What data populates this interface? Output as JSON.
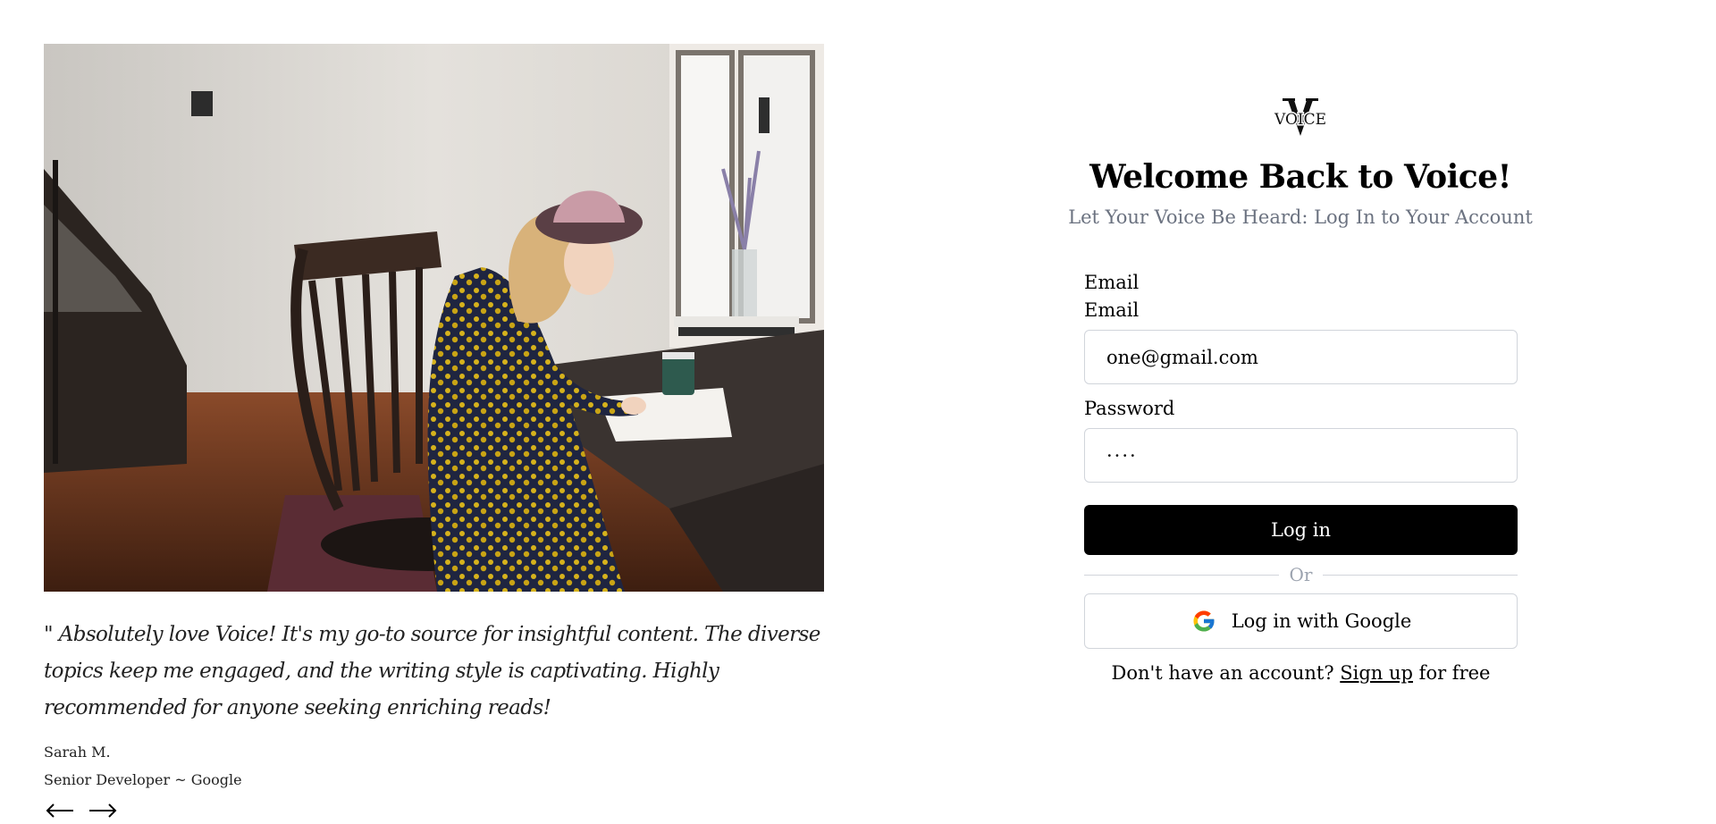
{
  "testimonial": {
    "quote": "\" Absolutely love Voice! It's my go-to source for insightful content. The diverse topics keep me engaged, and the writing style is captivating. Highly recommended for anyone seeking enriching reads!",
    "author": "Sarah M.",
    "role": "Senior Developer ~ Google",
    "prev_icon": "arrow-left-icon",
    "next_icon": "arrow-right-icon"
  },
  "brand": {
    "logo_text": "VOICE"
  },
  "header": {
    "title": "Welcome Back to Voice!",
    "subtitle": "Let Your Voice Be Heard: Log In to Your Account"
  },
  "form": {
    "email_heading": "Email",
    "email_label": "Email",
    "email_value": "one@gmail.com",
    "password_label": "Password",
    "password_value": "····",
    "login_label": "Log in",
    "divider_label": "Or",
    "google_label": "Log in with Google",
    "google_icon": "google-icon"
  },
  "signup": {
    "prefix": "Don't have an account?",
    "link_label": "Sign up",
    "suffix": "for free"
  },
  "colors": {
    "primary_button": "#000000",
    "subtitle_text": "#6b7280",
    "border": "#d1d5db"
  }
}
